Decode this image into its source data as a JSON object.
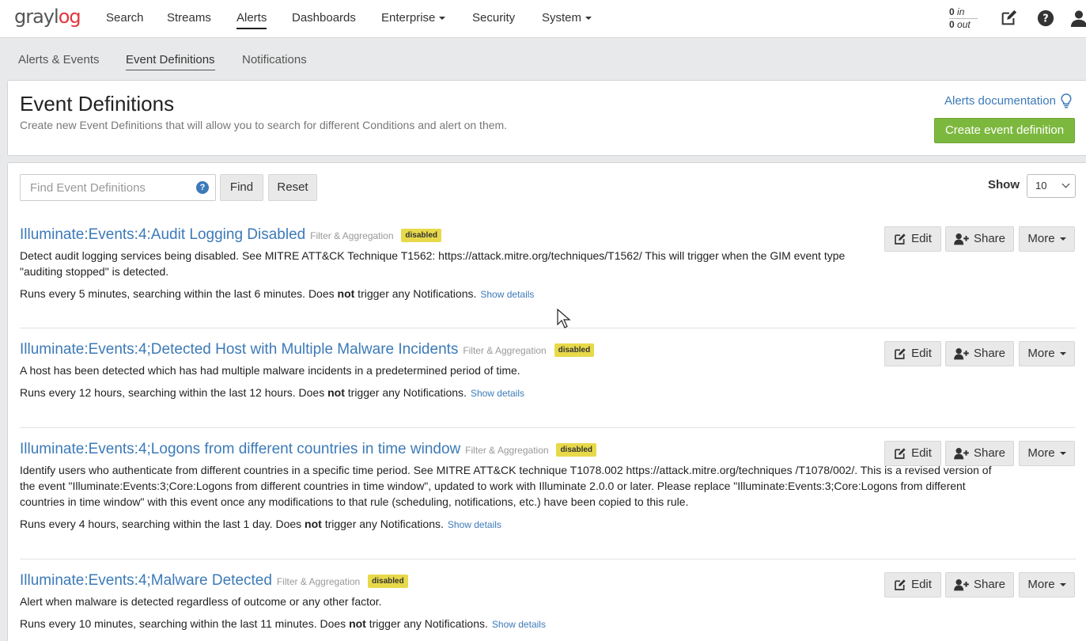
{
  "navbar": {
    "logo_main": "grayl",
    "logo_accent": "og",
    "items": [
      {
        "label": "Search"
      },
      {
        "label": "Streams"
      },
      {
        "label": "Alerts"
      },
      {
        "label": "Dashboards"
      },
      {
        "label": "Enterprise"
      },
      {
        "label": "Security"
      },
      {
        "label": "System"
      }
    ],
    "throughput_in_value": "0",
    "throughput_in_label": "in",
    "throughput_out_value": "0",
    "throughput_out_label": "out",
    "icons": [
      "edit-icon",
      "help-icon",
      "user-icon"
    ]
  },
  "subnav": {
    "items": [
      {
        "label": "Alerts & Events"
      },
      {
        "label": "Event Definitions"
      },
      {
        "label": "Notifications"
      }
    ],
    "active": "Event Definitions"
  },
  "header": {
    "title": "Event Definitions",
    "description": "Create new Event Definitions that will allow you to search for different Conditions and alert on them.",
    "doc_link": "Alerts documentation",
    "create_button": "Create event definition"
  },
  "search": {
    "placeholder": "Find Event Definitions",
    "help": "?",
    "find_button": "Find",
    "reset_button": "Reset",
    "show_label": "Show",
    "page_size": "10"
  },
  "entries": [
    {
      "title": "Illuminate:Events:4:Audit Logging Disabled",
      "type": "Filter & Aggregation",
      "status": "disabled",
      "description": "Detect audit logging services being disabled. See MITRE ATT&CK Technique T1562: https://attack.mitre.org/techniques/T1562/ This will trigger when the GIM event type \"auditing stopped\" is detected.",
      "schedule_pre": "Runs every 5 minutes, searching within the last 6 minutes. Does ",
      "schedule_bold": "not",
      "schedule_post": " trigger any Notifications.",
      "details_link": "Show details"
    },
    {
      "title": "Illuminate:Events:4;Detected Host with Multiple Malware Incidents",
      "type": "Filter & Aggregation",
      "status": "disabled",
      "description": "A host has been detected which has had multiple malware incidents in a predetermined period of time.",
      "schedule_pre": "Runs every 12 hours, searching within the last 12 hours. Does ",
      "schedule_bold": "not",
      "schedule_post": " trigger any Notifications.",
      "details_link": "Show details"
    },
    {
      "title": "Illuminate:Events:4;Logons from different countries in time window",
      "type": "Filter & Aggregation",
      "status": "disabled",
      "description": "Identify users who authenticate from different countries in a specific time period. See MITRE ATT&CK technique T1078.002 https://attack.mitre.org/techniques /T1078/002/. This is a revised version of the event \"Illuminate:Events:3;Core:Logons from different countries in time window\", updated to work with Illuminate 2.0.0 or later. Please replace \"Illuminate:Events:3;Core:Logons from different countries in time window\" with this event once any modifications to that rule (scheduling, notifications, etc.) have been copied to this rule.",
      "schedule_pre": "Runs every 4 hours, searching within the last 1 day. Does ",
      "schedule_bold": "not",
      "schedule_post": " trigger any Notifications.",
      "details_link": "Show details"
    },
    {
      "title": "Illuminate:Events:4;Malware Detected",
      "type": "Filter & Aggregation",
      "status": "disabled",
      "description": "Alert when malware is detected regardless of outcome or any other factor.",
      "schedule_pre": "Runs every 10 minutes, searching within the last 11 minutes. Does ",
      "schedule_bold": "not",
      "schedule_post": " trigger any Notifications.",
      "details_link": "Show details"
    }
  ],
  "actions": {
    "edit": "Edit",
    "share": "Share",
    "more": "More"
  },
  "colors": {
    "link": "#3c7ab8",
    "primary_button": "#7cb83e",
    "badge": "#e8d94a",
    "logo_accent": "#e0383e"
  }
}
